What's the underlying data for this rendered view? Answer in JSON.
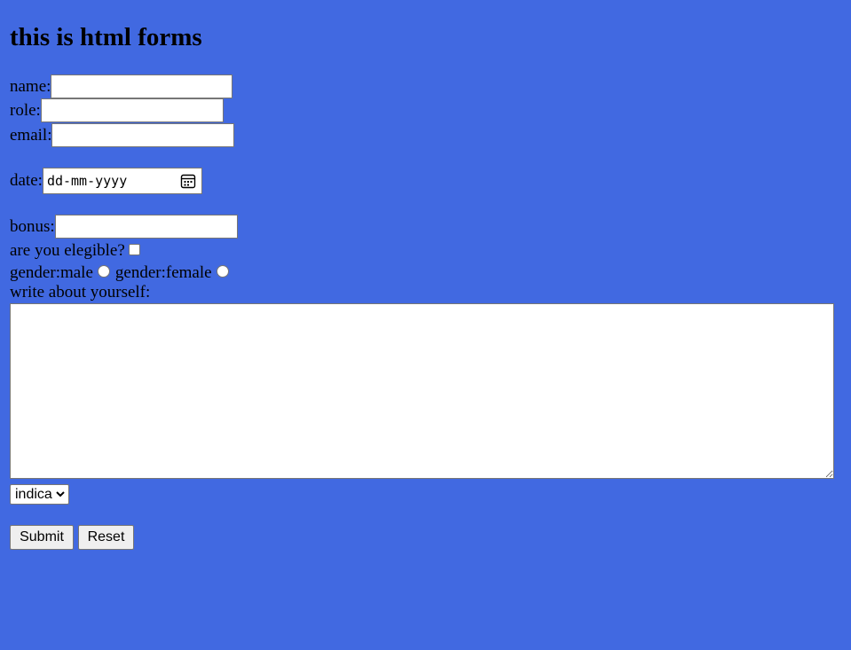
{
  "heading": "this is html forms",
  "fields": {
    "name_label": "name:",
    "role_label": "role:",
    "email_label": "email:",
    "date_label": "date:",
    "date_placeholder": "dd-mm-yyyy",
    "bonus_label": "bonus:",
    "eligible_label": "are you elegible?",
    "gender_male_label": "gender:male",
    "gender_female_label": "gender:female",
    "about_label": "write about yourself:"
  },
  "select": {
    "selected": "indica"
  },
  "buttons": {
    "submit": "Submit",
    "reset": "Reset"
  },
  "icons": {
    "date": "calendar-icon",
    "select": "chevron-down-icon"
  },
  "colors": {
    "background": "#4169e1"
  }
}
